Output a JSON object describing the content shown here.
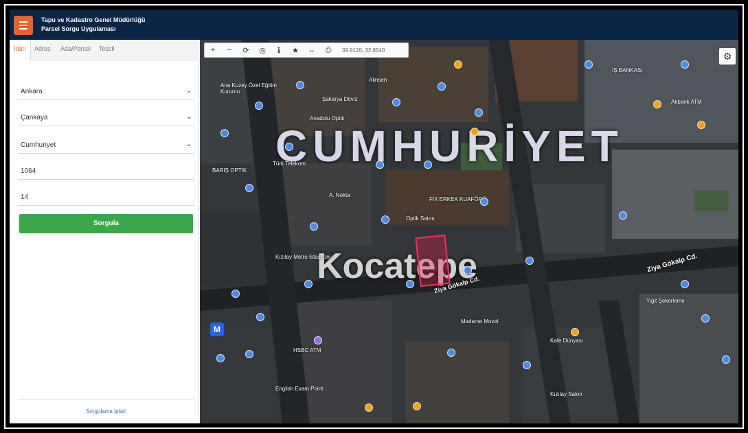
{
  "header": {
    "title_line1": "Tapu ve Kadastro Genel Müdürlüğü",
    "title_line2": "Parsel Sorgu Uygulaması"
  },
  "sidebar": {
    "tabs": [
      "İdari",
      "Adres",
      "Ada/Parsel",
      "Tescil"
    ],
    "active_tab": "İdari",
    "fields": [
      {
        "name": "il",
        "value": "Ankara",
        "dropdown": true
      },
      {
        "name": "ilce",
        "value": "Çankaya",
        "dropdown": true
      },
      {
        "name": "mahalle",
        "value": "Cumhuriyet",
        "dropdown": true
      },
      {
        "name": "ada",
        "value": "1064",
        "dropdown": false
      },
      {
        "name": "parsel",
        "value": "14",
        "dropdown": false
      }
    ],
    "query_button": "Sorgula",
    "footer_link": "Sorgulama İptali"
  },
  "toolbar": {
    "icons": [
      "plus-icon",
      "minus-icon",
      "refresh-icon",
      "target-icon",
      "info-icon",
      "star-icon",
      "measure-icon",
      "print-icon"
    ],
    "coords": "39.9120, 32.8540"
  },
  "map": {
    "big_labels": {
      "neighborhood": "CUMHURİYET",
      "area": "Kocatepe"
    },
    "streets": {
      "ziya1": "Ziya Gökalp Cd.",
      "ziya2": "Ziya Gökalp Cd."
    },
    "labels": [
      {
        "text": "Alinsen"
      },
      {
        "text": "Ana Kuzey Özel Eğitim Kurumu"
      },
      {
        "text": "Şakarya Döviz"
      },
      {
        "text": "Anadolu Optik"
      },
      {
        "text": "Türk Telekom"
      },
      {
        "text": "BARIŞ OPTİK"
      },
      {
        "text": "A. Nokta"
      },
      {
        "text": "FİX ERKEK KUAFÖRÜ"
      },
      {
        "text": "Optik Satım"
      },
      {
        "text": "Kızılay Metro İstasyonu"
      },
      {
        "text": "HSBC ATM"
      },
      {
        "text": "Madame Mozel"
      },
      {
        "text": "English Exam Point"
      },
      {
        "text": "Kafe Dünyası"
      },
      {
        "text": "Akbank ATM"
      },
      {
        "text": "İŞ BANKASI"
      },
      {
        "text": "Yiğit Şekerleme"
      },
      {
        "text": "Kızılay Salon"
      }
    ],
    "metro": "M"
  }
}
